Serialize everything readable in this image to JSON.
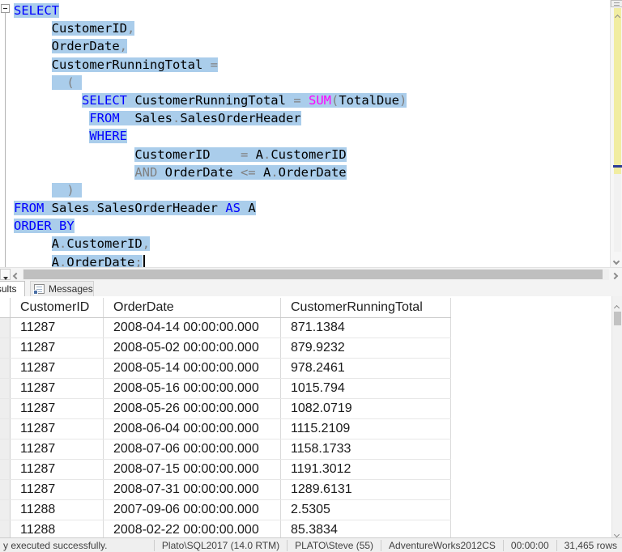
{
  "colors": {
    "keyword": "#0000ff",
    "function": "#ff00ff",
    "operator": "#808080",
    "identifier": "#000000",
    "selection": "#aacdeb",
    "scroll_annotation_yellow": "#f1eda2",
    "scroll_caret_marker": "#2c3c97"
  },
  "editor": {
    "lines": [
      {
        "indent": 0,
        "segs": [
          {
            "t": "SELECT",
            "c": "kw"
          }
        ]
      },
      {
        "indent": 5,
        "segs": [
          {
            "t": "CustomerID",
            "c": "id"
          },
          {
            "t": ",",
            "c": "op"
          }
        ]
      },
      {
        "indent": 5,
        "segs": [
          {
            "t": "OrderDate",
            "c": "id"
          },
          {
            "t": ",",
            "c": "op"
          }
        ]
      },
      {
        "indent": 5,
        "segs": [
          {
            "t": "CustomerRunningTotal ",
            "c": "id"
          },
          {
            "t": "=",
            "c": "op"
          }
        ]
      },
      {
        "indent": 5,
        "segs": [
          {
            "t": "  ( ",
            "c": "op"
          }
        ]
      },
      {
        "indent": 9,
        "segs": [
          {
            "t": "SELECT",
            "c": "kw"
          },
          {
            "t": " CustomerRunningTotal ",
            "c": "id"
          },
          {
            "t": "= ",
            "c": "op"
          },
          {
            "t": "SUM",
            "c": "fn"
          },
          {
            "t": "(",
            "c": "op"
          },
          {
            "t": "TotalDue",
            "c": "id"
          },
          {
            "t": ")",
            "c": "op"
          }
        ]
      },
      {
        "indent": 10,
        "segs": [
          {
            "t": "FROM",
            "c": "kw"
          },
          {
            "t": "  Sales",
            "c": "id"
          },
          {
            "t": ".",
            "c": "op"
          },
          {
            "t": "SalesOrderHeader",
            "c": "id"
          }
        ]
      },
      {
        "indent": 10,
        "segs": [
          {
            "t": "WHERE",
            "c": "kw"
          }
        ]
      },
      {
        "indent": 16,
        "segs": [
          {
            "t": "CustomerID    ",
            "c": "id"
          },
          {
            "t": "= ",
            "c": "op"
          },
          {
            "t": "A",
            "c": "id"
          },
          {
            "t": ".",
            "c": "op"
          },
          {
            "t": "CustomerID",
            "c": "id"
          }
        ]
      },
      {
        "indent": 16,
        "segs": [
          {
            "t": "AND ",
            "c": "op"
          },
          {
            "t": "OrderDate ",
            "c": "id"
          },
          {
            "t": "<= ",
            "c": "op"
          },
          {
            "t": "A",
            "c": "id"
          },
          {
            "t": ".",
            "c": "op"
          },
          {
            "t": "OrderDate",
            "c": "id"
          }
        ]
      },
      {
        "indent": 5,
        "segs": [
          {
            "t": "  ) ",
            "c": "op"
          }
        ]
      },
      {
        "indent": 0,
        "segs": [
          {
            "t": "FROM",
            "c": "kw"
          },
          {
            "t": " Sales",
            "c": "id"
          },
          {
            "t": ".",
            "c": "op"
          },
          {
            "t": "SalesOrderHeader ",
            "c": "id"
          },
          {
            "t": "AS",
            "c": "kw"
          },
          {
            "t": " A",
            "c": "id"
          }
        ]
      },
      {
        "indent": 0,
        "segs": [
          {
            "t": "ORDER BY",
            "c": "kw"
          }
        ]
      },
      {
        "indent": 5,
        "segs": [
          {
            "t": "A",
            "c": "id"
          },
          {
            "t": ".",
            "c": "op"
          },
          {
            "t": "CustomerID",
            "c": "id"
          },
          {
            "t": ",",
            "c": "op"
          }
        ]
      },
      {
        "indent": 5,
        "segs": [
          {
            "t": "A",
            "c": "id"
          },
          {
            "t": ".",
            "c": "op"
          },
          {
            "t": "OrderDate",
            "c": "id"
          },
          {
            "t": ";",
            "c": "op"
          }
        ],
        "caret": true
      }
    ]
  },
  "tabs": {
    "results_label": "Results",
    "messages_label": "Messages"
  },
  "grid": {
    "columns": [
      "CustomerID",
      "OrderDate",
      "CustomerRunningTotal"
    ],
    "rows": [
      [
        "11287",
        "2008-04-14 00:00:00.000",
        "871.1384"
      ],
      [
        "11287",
        "2008-05-02 00:00:00.000",
        "879.9232"
      ],
      [
        "11287",
        "2008-05-14 00:00:00.000",
        "978.2461"
      ],
      [
        "11287",
        "2008-05-16 00:00:00.000",
        "1015.794"
      ],
      [
        "11287",
        "2008-05-26 00:00:00.000",
        "1082.0719"
      ],
      [
        "11287",
        "2008-06-04 00:00:00.000",
        "1115.2109"
      ],
      [
        "11287",
        "2008-07-06 00:00:00.000",
        "1158.1733"
      ],
      [
        "11287",
        "2008-07-15 00:00:00.000",
        "1191.3012"
      ],
      [
        "11287",
        "2008-07-31 00:00:00.000",
        "1289.6131"
      ],
      [
        "11288",
        "2007-09-06 00:00:00.000",
        "2.5305"
      ],
      [
        "11288",
        "2008-02-22 00:00:00.000",
        "85.3834"
      ]
    ]
  },
  "status": {
    "message": "y executed successfully.",
    "server": "Plato\\SQL2017 (14.0 RTM)",
    "user": "PLATO\\Steve (55)",
    "database": "AdventureWorks2012CS",
    "duration": "00:00:00",
    "row_count": "31,465 rows"
  }
}
